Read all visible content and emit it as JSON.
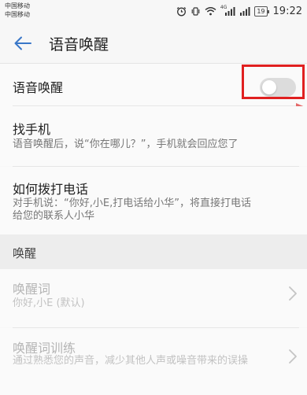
{
  "status_bar": {
    "carrier_1": "中国移动",
    "carrier_2": "中国移动",
    "network_label": "4G",
    "battery": "19",
    "time": "19:22"
  },
  "app_bar": {
    "title": "语音唤醒"
  },
  "voice_wakeup": {
    "label": "语音唤醒",
    "enabled": false
  },
  "find_phone": {
    "title": "找手机",
    "description": "语音唤醒后，说“你在哪儿？”，手机就会回应您了"
  },
  "make_call": {
    "title": "如何拨打电话",
    "description_line1": "对手机说：“你好,小E,打电话给小华”，将直接打电话",
    "description_line2": "给您的联系人小华"
  },
  "section": {
    "label": "唤醒"
  },
  "wake_word": {
    "title": "唤醒词",
    "value": "你好,小E (默认)"
  },
  "wake_word_training": {
    "title": "唤醒词训练",
    "description": "通过熟悉您的声音，减少其他人声或噪音带来的误操"
  },
  "colors": {
    "highlight": "#e02020",
    "accent": "#3a77c8"
  }
}
